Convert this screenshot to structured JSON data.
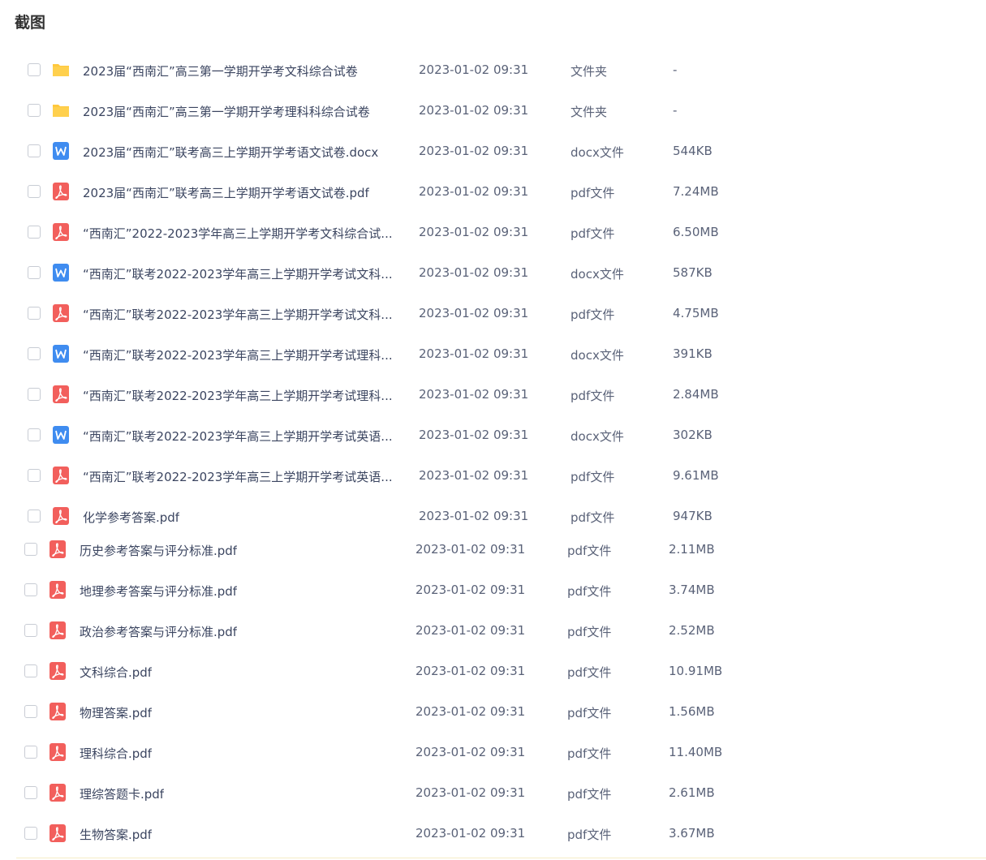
{
  "page": {
    "title": "截图"
  },
  "files": [
    {
      "name": "2023届“西南汇”高三第一学期开学考文科综合试卷",
      "date": "2023-01-02 09:31",
      "type": "文件夹",
      "size": "-",
      "icon": "folder-icon"
    },
    {
      "name": "2023届“西南汇”高三第一学期开学考理科科综合试卷",
      "date": "2023-01-02 09:31",
      "type": "文件夹",
      "size": "-",
      "icon": "folder-icon"
    },
    {
      "name": "2023届“西南汇”联考高三上学期开学考语文试卷.docx",
      "date": "2023-01-02 09:31",
      "type": "docx文件",
      "size": "544KB",
      "icon": "word-icon"
    },
    {
      "name": "2023届“西南汇”联考高三上学期开学考语文试卷.pdf",
      "date": "2023-01-02 09:31",
      "type": "pdf文件",
      "size": "7.24MB",
      "icon": "pdf-icon"
    },
    {
      "name": "“西南汇”2022-2023学年高三上学期开学考文科综合试...",
      "date": "2023-01-02 09:31",
      "type": "pdf文件",
      "size": "6.50MB",
      "icon": "pdf-icon"
    },
    {
      "name": "“西南汇”联考2022-2023学年高三上学期开学考试文科...",
      "date": "2023-01-02 09:31",
      "type": "docx文件",
      "size": "587KB",
      "icon": "word-icon"
    },
    {
      "name": "“西南汇”联考2022-2023学年高三上学期开学考试文科...",
      "date": "2023-01-02 09:31",
      "type": "pdf文件",
      "size": "4.75MB",
      "icon": "pdf-icon"
    },
    {
      "name": "“西南汇”联考2022-2023学年高三上学期开学考试理科...",
      "date": "2023-01-02 09:31",
      "type": "docx文件",
      "size": "391KB",
      "icon": "word-icon"
    },
    {
      "name": "“西南汇”联考2022-2023学年高三上学期开学考试理科...",
      "date": "2023-01-02 09:31",
      "type": "pdf文件",
      "size": "2.84MB",
      "icon": "pdf-icon"
    },
    {
      "name": "“西南汇”联考2022-2023学年高三上学期开学考试英语...",
      "date": "2023-01-02 09:31",
      "type": "docx文件",
      "size": "302KB",
      "icon": "word-icon"
    },
    {
      "name": "“西南汇”联考2022-2023学年高三上学期开学考试英语...",
      "date": "2023-01-02 09:31",
      "type": "pdf文件",
      "size": "9.61MB",
      "icon": "pdf-icon"
    },
    {
      "name": "化学参考答案.pdf",
      "date": "2023-01-02 09:31",
      "type": "pdf文件",
      "size": "947KB",
      "icon": "pdf-icon"
    },
    {
      "name": "历史参考答案与评分标准.pdf",
      "date": "2023-01-02 09:31",
      "type": "pdf文件",
      "size": "2.11MB",
      "icon": "pdf-icon"
    },
    {
      "name": "地理参考答案与评分标准.pdf",
      "date": "2023-01-02 09:31",
      "type": "pdf文件",
      "size": "3.74MB",
      "icon": "pdf-icon"
    },
    {
      "name": "政治参考答案与评分标准.pdf",
      "date": "2023-01-02 09:31",
      "type": "pdf文件",
      "size": "2.52MB",
      "icon": "pdf-icon"
    },
    {
      "name": "文科综合.pdf",
      "date": "2023-01-02 09:31",
      "type": "pdf文件",
      "size": "10.91MB",
      "icon": "pdf-icon"
    },
    {
      "name": "物理答案.pdf",
      "date": "2023-01-02 09:31",
      "type": "pdf文件",
      "size": "1.56MB",
      "icon": "pdf-icon"
    },
    {
      "name": "理科综合.pdf",
      "date": "2023-01-02 09:31",
      "type": "pdf文件",
      "size": "11.40MB",
      "icon": "pdf-icon"
    },
    {
      "name": "理综答题卡.pdf",
      "date": "2023-01-02 09:31",
      "type": "pdf文件",
      "size": "2.61MB",
      "icon": "pdf-icon"
    },
    {
      "name": "生物答案.pdf",
      "date": "2023-01-02 09:31",
      "type": "pdf文件",
      "size": "3.67MB",
      "icon": "pdf-icon"
    }
  ],
  "colors": {
    "folder": "#ffc83d",
    "word": "#3f8cf0",
    "pdf": "#f25f5c"
  }
}
